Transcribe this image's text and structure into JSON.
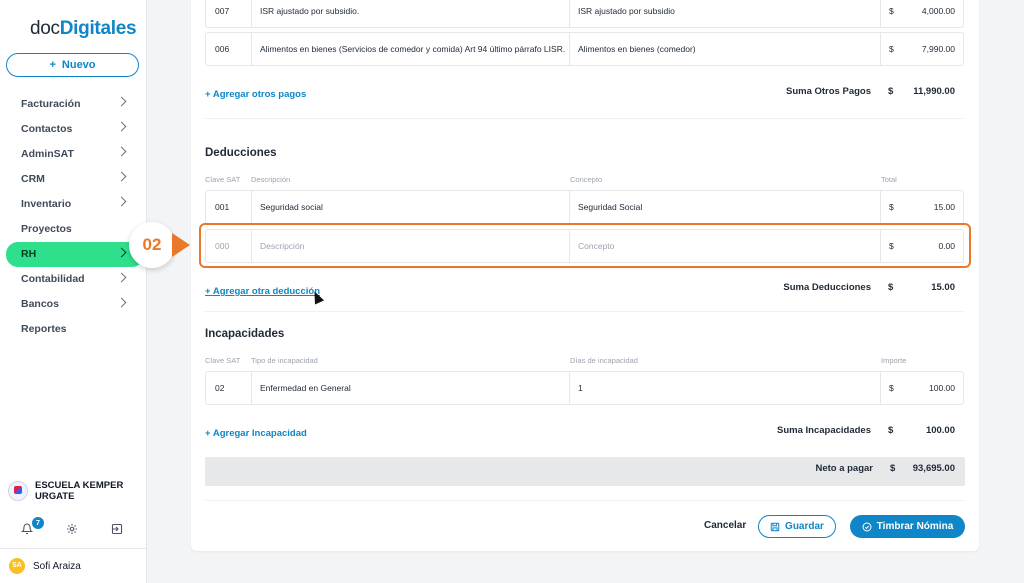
{
  "sidebar": {
    "logo_prefix": "doc",
    "logo_brand": "Digitales",
    "new_button": "Nuevo",
    "items": [
      {
        "label": "Facturación",
        "chevron": true
      },
      {
        "label": "Contactos",
        "chevron": true
      },
      {
        "label": "AdminSAT",
        "chevron": true
      },
      {
        "label": "CRM",
        "chevron": true
      },
      {
        "label": "Inventario",
        "chevron": true
      },
      {
        "label": "Proyectos",
        "chevron": false
      },
      {
        "label": "RH",
        "chevron": true,
        "active": true
      },
      {
        "label": "Contabilidad",
        "chevron": true
      },
      {
        "label": "Bancos",
        "chevron": true
      },
      {
        "label": "Reportes",
        "chevron": false
      }
    ],
    "company": "ESCUELA KEMPER URGATE",
    "notification_count": "7",
    "user_initials": "SA",
    "user_name": "Sofi Araiza"
  },
  "otros_pagos": {
    "rows": [
      {
        "code": "007",
        "description": "ISR ajustado por subsidio.",
        "concept": "ISR ajustado por subsidio",
        "currency": "$",
        "amount": "4,000.00"
      },
      {
        "code": "006",
        "description": "Alimentos en bienes (Servicios de comedor y comida) Art 94 último párrafo LISR.",
        "concept": "Alimentos en bienes (comedor)",
        "currency": "$",
        "amount": "7,990.00"
      }
    ],
    "add_link": "+ Agregar otros pagos",
    "sum_label": "Suma Otros Pagos",
    "sum_currency": "$",
    "sum_value": "11,990.00"
  },
  "deducciones": {
    "title": "Deducciones",
    "headers": {
      "code": "Clave SAT",
      "description": "Descripción",
      "concept": "Concepto",
      "total": "Total"
    },
    "rows": [
      {
        "code": "001",
        "description": "Seguridad social",
        "concept": "Seguridad Social",
        "currency": "$",
        "amount": "15.00"
      }
    ],
    "new_row": {
      "code_placeholder": "000",
      "description_placeholder": "Descripción",
      "concept_placeholder": "Concepto",
      "currency": "$",
      "amount": "0.00"
    },
    "add_link": "+ Agregar otra deducción",
    "sum_label": "Suma Deducciones",
    "sum_currency": "$",
    "sum_value": "15.00"
  },
  "incapacidades": {
    "title": "Incapacidades",
    "headers": {
      "code": "Clave SAT",
      "type": "Tipo de incapacidad",
      "days": "Días de incapacidad",
      "amount": "Importe"
    },
    "rows": [
      {
        "code": "02",
        "type": "Enfermedad en General",
        "days": "1",
        "currency": "$",
        "amount": "100.00"
      }
    ],
    "add_link": "+ Agregar Incapacidad",
    "sum_label": "Suma Incapacidades",
    "sum_currency": "$",
    "sum_value": "100.00"
  },
  "net": {
    "label": "Neto a pagar",
    "currency": "$",
    "value": "93,695.00"
  },
  "actions": {
    "cancel": "Cancelar",
    "save": "Guardar",
    "stamp": "Timbrar Nómina"
  },
  "annotation": {
    "step": "02",
    "color": "#e9782b"
  },
  "colors": {
    "accent": "#0e86c7",
    "active_nav": "#2ee08c"
  }
}
